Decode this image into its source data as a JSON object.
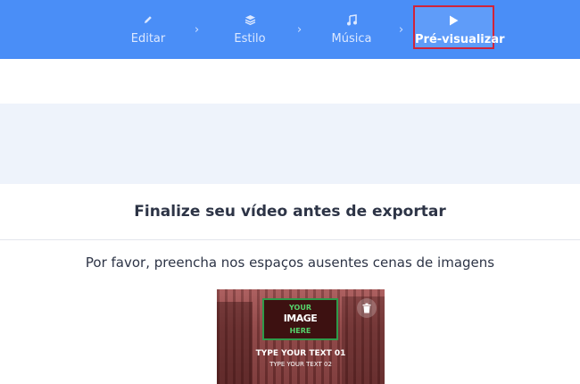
{
  "steps": [
    {
      "label": "Editar",
      "icon": "pencil-icon"
    },
    {
      "label": "Estilo",
      "icon": "layers-icon"
    },
    {
      "label": "Música",
      "icon": "music-note-icon"
    },
    {
      "label": "Pré-visualizar",
      "icon": "play-icon",
      "active": true
    }
  ],
  "separator_icon": "chevron-right-icon",
  "main": {
    "title": "Finalize seu vídeo antes de exportar",
    "subtitle": "Por favor, preencha nos espaços ausentes cenas de imagens"
  },
  "thumbnail": {
    "placeholder_line1": "YOUR",
    "placeholder_line2": "IMAGE",
    "placeholder_line3": "HERE",
    "caption1": "TYPE YOUR TEXT 01",
    "caption2": "TYPE YOUR TEXT 02",
    "delete_icon": "trash-icon"
  },
  "colors": {
    "header_bg": "#4a8ef7",
    "active_step_border": "#d0243a",
    "placeholder_green": "#56d36b"
  }
}
